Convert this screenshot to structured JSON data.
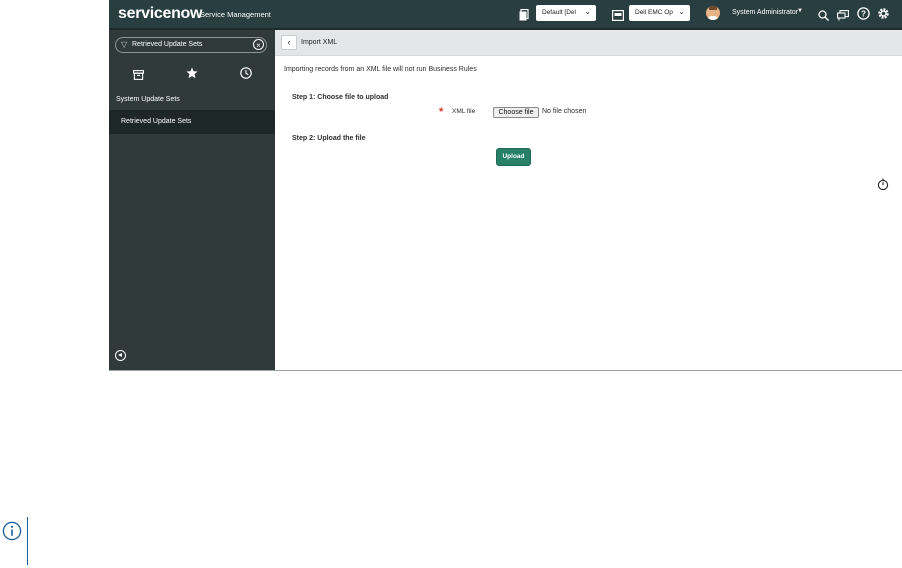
{
  "header": {
    "logo": "servicenow",
    "product": "Service Management",
    "update_set": "Default [Del",
    "domain": "Dell EMC Op",
    "user_name": "System Administrator",
    "icons": [
      "update-set-icon",
      "domain-icon",
      "search-icon",
      "chat-icon",
      "help-icon",
      "gear-icon"
    ]
  },
  "sidebar": {
    "filter_value": "Retrieved Update Sets",
    "tabs": [
      "all-apps-icon",
      "favorites-star-icon",
      "history-clock-icon"
    ],
    "section_header": "System Update Sets",
    "items": [
      {
        "label": "Retrieved Update Sets"
      }
    ]
  },
  "main": {
    "title": "Import XML",
    "warning": "Importing records from an XML file will not run Business Rules",
    "step1": "Step 1: Choose file to upload",
    "xml_label": "XML file",
    "choose_label": "Choose file",
    "no_file": "No file chosen",
    "step2": "Step 2: Upload the file",
    "upload_label": "Upload"
  },
  "colors": {
    "header_bg": "#293e40",
    "sidebar_bg": "#303a3b",
    "nav_selected_bg": "#1e2728",
    "upload_button": "#278168",
    "required_marker": "#d9352c",
    "info_icon": "#1b5e9b"
  }
}
